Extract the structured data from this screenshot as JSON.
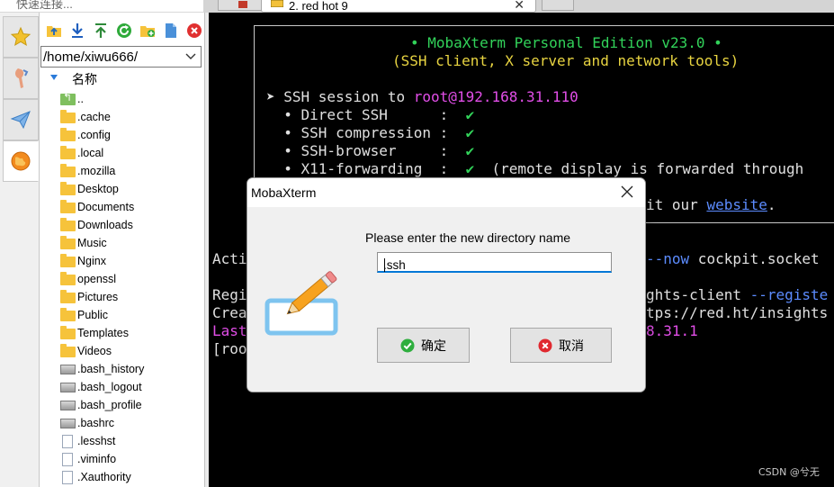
{
  "quick_connect": {
    "placeholder": "快速连接..."
  },
  "tabs": [
    {
      "label": "2. red hot 9"
    }
  ],
  "file_panel": {
    "path": "/home/xiwu666/",
    "column_header": "名称",
    "items": [
      {
        "name": "..",
        "type": "up"
      },
      {
        "name": ".cache",
        "type": "folder"
      },
      {
        "name": ".config",
        "type": "folder"
      },
      {
        "name": ".local",
        "type": "folder"
      },
      {
        "name": ".mozilla",
        "type": "folder"
      },
      {
        "name": "Desktop",
        "type": "folder"
      },
      {
        "name": "Documents",
        "type": "folder"
      },
      {
        "name": "Downloads",
        "type": "folder"
      },
      {
        "name": "Music",
        "type": "folder"
      },
      {
        "name": "Nginx",
        "type": "folder"
      },
      {
        "name": "openssl",
        "type": "folder"
      },
      {
        "name": "Pictures",
        "type": "folder"
      },
      {
        "name": "Public",
        "type": "folder"
      },
      {
        "name": "Templates",
        "type": "folder"
      },
      {
        "name": "Videos",
        "type": "folder"
      },
      {
        "name": ".bash_history",
        "type": "binary"
      },
      {
        "name": ".bash_logout",
        "type": "binary"
      },
      {
        "name": ".bash_profile",
        "type": "binary"
      },
      {
        "name": ".bashrc",
        "type": "binary"
      },
      {
        "name": ".lesshst",
        "type": "document"
      },
      {
        "name": ".viminfo",
        "type": "document"
      },
      {
        "name": ".Xauthority",
        "type": "document"
      }
    ]
  },
  "terminal": {
    "banner_title": "• MobaXterm Personal Edition v23.0 •",
    "banner_subtitle": "(SSH client, X server and network tools)",
    "session_prefix": "➤ SSH session to ",
    "session_host": "root@192.168.31.110",
    "features": [
      {
        "label": "  • Direct SSH      :  ",
        "check": "✔",
        "note": ""
      },
      {
        "label": "  • SSH compression :  ",
        "check": "✔",
        "note": ""
      },
      {
        "label": "  • SSH-browser     :  ",
        "check": "✔",
        "note": ""
      },
      {
        "label": "  • X11-forwarding  :  ",
        "check": "✔",
        "note": "  (remote display is forwarded through"
      }
    ],
    "visit_prefix": "it our ",
    "visit_link": "website",
    "visit_suffix": ".",
    "activate_left": "Acti",
    "activate_opt": "--now",
    "activate_rest": " cockpit.socket",
    "register_left": "Regi",
    "register_mid": "ghts-client ",
    "register_opt": "--registe",
    "create_left": "Crea",
    "create_right": "tps://red.ht/insights",
    "last_left": "Last",
    "last_right": "8.31.1",
    "prompt_left": "[roo"
  },
  "watermark": "CSDN @兮无",
  "dialog": {
    "title": "MobaXterm",
    "prompt": "Please enter the new directory name",
    "input_value": ".ssh",
    "ok_label": "确定",
    "cancel_label": "取消"
  },
  "colors": {
    "terminal_bg": "#000000",
    "accent_green": "#32d35a",
    "accent_yellow": "#e8d441",
    "accent_magenta": "#e24ee8",
    "link_blue": "#5c8cff",
    "focus_blue": "#0078d7"
  }
}
